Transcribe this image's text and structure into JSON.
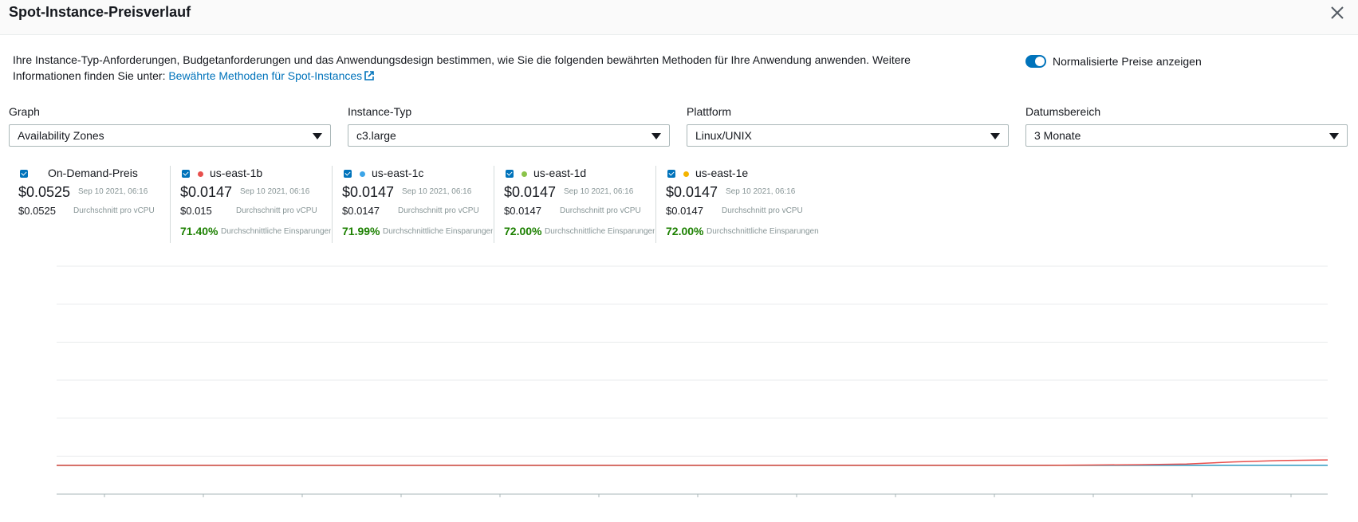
{
  "modal": {
    "title": "Spot-Instance-Preisverlauf"
  },
  "description": {
    "text": "Ihre Instance-Typ-Anforderungen, Budgetanforderungen und das Anwendungsdesign bestimmen, wie Sie die folgenden bewährten Methoden für Ihre Anwendung anwenden. Weitere Informationen finden Sie unter: ",
    "link_text": "Bewährte Methoden für Spot-Instances"
  },
  "toggle": {
    "label": "Normalisierte Preise anzeigen",
    "on": true
  },
  "filters": [
    {
      "label": "Graph",
      "value": "Availability Zones"
    },
    {
      "label": "Instance-Typ",
      "value": "c3.large"
    },
    {
      "label": "Plattform",
      "value": "Linux/UNIX"
    },
    {
      "label": "Datumsbereich",
      "value": "3 Monate"
    }
  ],
  "series": [
    {
      "name": "On-Demand-Preis",
      "price": "$0.0525",
      "timestamp": "Sep 10 2021, 06:16",
      "avg": "$0.0525",
      "avg_label": "Durchschnitt pro vCPU",
      "savings": "",
      "savings_label": "",
      "color": ""
    },
    {
      "name": "us-east-1b",
      "price": "$0.0147",
      "timestamp": "Sep 10 2021, 06:16",
      "avg": "$0.015",
      "avg_label": "Durchschnitt pro vCPU",
      "savings": "71.40%",
      "savings_label": "Durchschnittliche Einsparungen",
      "color": "#e8504d"
    },
    {
      "name": "us-east-1c",
      "price": "$0.0147",
      "timestamp": "Sep 10 2021, 06:16",
      "avg": "$0.0147",
      "avg_label": "Durchschnitt pro vCPU",
      "savings": "71.99%",
      "savings_label": "Durchschnittliche Einsparungen",
      "color": "#3da5e8"
    },
    {
      "name": "us-east-1d",
      "price": "$0.0147",
      "timestamp": "Sep 10 2021, 06:16",
      "avg": "$0.0147",
      "avg_label": "Durchschnitt pro vCPU",
      "savings": "72.00%",
      "savings_label": "Durchschnittliche Einsparungen",
      "color": "#8bc34a"
    },
    {
      "name": "us-east-1e",
      "price": "$0.0147",
      "timestamp": "Sep 10 2021, 06:16",
      "avg": "$0.0147",
      "avg_label": "Durchschnitt pro vCPU",
      "savings": "72.00%",
      "savings_label": "Durchschnittliche Einsparungen",
      "color": "#f4b400"
    }
  ],
  "colors": {
    "accent": "#0073bb",
    "savings_green": "#1d8102"
  },
  "chart_data": {
    "type": "line",
    "gridlines": 7,
    "xticks": 13,
    "series": [
      {
        "name": "us-east-1b",
        "color": "#e8504d",
        "values": [
          0.0147,
          0.0147,
          0.0147,
          0.0147,
          0.0147,
          0.0147,
          0.0147,
          0.0147,
          0.0147,
          0.0147,
          0.0147,
          0.0147,
          0.0147,
          0.0147,
          0.0147,
          0.0147,
          0.0147,
          0.0147,
          0.0147,
          0.0147,
          0.0147,
          0.0147,
          0.01475,
          0.0148,
          0.0149,
          0.0152,
          0.0154,
          0.0155
        ]
      },
      {
        "name": "us-east-1c",
        "color": "#3da5e8",
        "values": [
          0.0147,
          0.0147,
          0.0147,
          0.0147,
          0.0147,
          0.0147,
          0.0147,
          0.0147,
          0.0147,
          0.0147,
          0.0147,
          0.0147,
          0.0147,
          0.0147,
          0.0147,
          0.0147,
          0.0147,
          0.0147,
          0.0147,
          0.0147,
          0.0147,
          0.0147,
          0.0147,
          0.0147,
          0.0147,
          0.0147,
          0.0147,
          0.0147
        ]
      },
      {
        "name": "us-east-1d",
        "color": "#8bc34a",
        "values": [
          0.0147,
          0.0147,
          0.0147,
          0.0147,
          0.0147,
          0.0147,
          0.0147,
          0.0147,
          0.0147,
          0.0147,
          0.0147,
          0.0147,
          0.0147,
          0.0147,
          0.0147,
          0.0147,
          0.0147,
          0.0147,
          0.0147,
          0.0147,
          0.0147,
          0.0147,
          0.0147,
          0.0147,
          0.0147,
          0.0147,
          0.0147,
          0.0147
        ]
      },
      {
        "name": "us-east-1e",
        "color": "#f4b400",
        "values": [
          0.0147,
          0.0147,
          0.0147,
          0.0147,
          0.0147,
          0.0147,
          0.0147,
          0.0147,
          0.0147,
          0.0147,
          0.0147,
          0.0147,
          0.0147,
          0.0147,
          0.0147,
          0.0147,
          0.0147,
          0.0147,
          0.0147,
          0.0147,
          0.0147,
          0.0147,
          0.0147,
          0.0147,
          0.0147,
          0.0147,
          0.0147,
          0.0147
        ]
      }
    ],
    "ylim": [
      0.0105,
      0.0438
    ]
  }
}
